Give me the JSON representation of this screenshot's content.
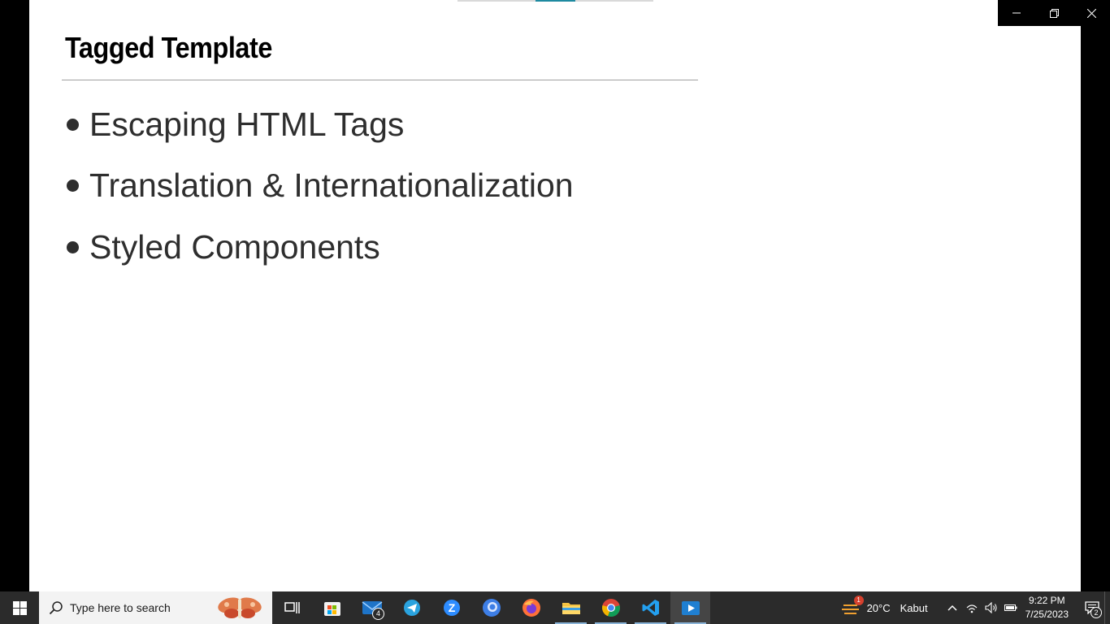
{
  "slide": {
    "title": "Tagged Template",
    "bullets": [
      "Escaping HTML Tags",
      "Translation & Internationalization",
      "Styled Components"
    ]
  },
  "taskbar": {
    "search_placeholder": "Type here to search",
    "apps": [
      {
        "name": "task-view-icon",
        "running": false
      },
      {
        "name": "microsoft-store-icon",
        "running": false
      },
      {
        "name": "mail-icon",
        "running": false,
        "badge": "4"
      },
      {
        "name": "telegram-icon",
        "running": false
      },
      {
        "name": "zoom-icon",
        "running": false
      },
      {
        "name": "browser-icon",
        "running": false
      },
      {
        "name": "firefox-icon",
        "running": false
      },
      {
        "name": "file-explorer-icon",
        "running": true
      },
      {
        "name": "chrome-icon",
        "running": true
      },
      {
        "name": "vscode-icon",
        "running": true
      },
      {
        "name": "media-player-icon",
        "running": true,
        "active": true
      }
    ],
    "weather": {
      "temp": "20°C",
      "condition": "Kabut",
      "badge": "1"
    },
    "clock": {
      "time": "9:22 PM",
      "date": "7/25/2023"
    },
    "notification_count": "2"
  },
  "colors": {
    "accent": "#1e8aa0",
    "taskbar": "#2b2b2b",
    "text": "#2e2e2e"
  }
}
